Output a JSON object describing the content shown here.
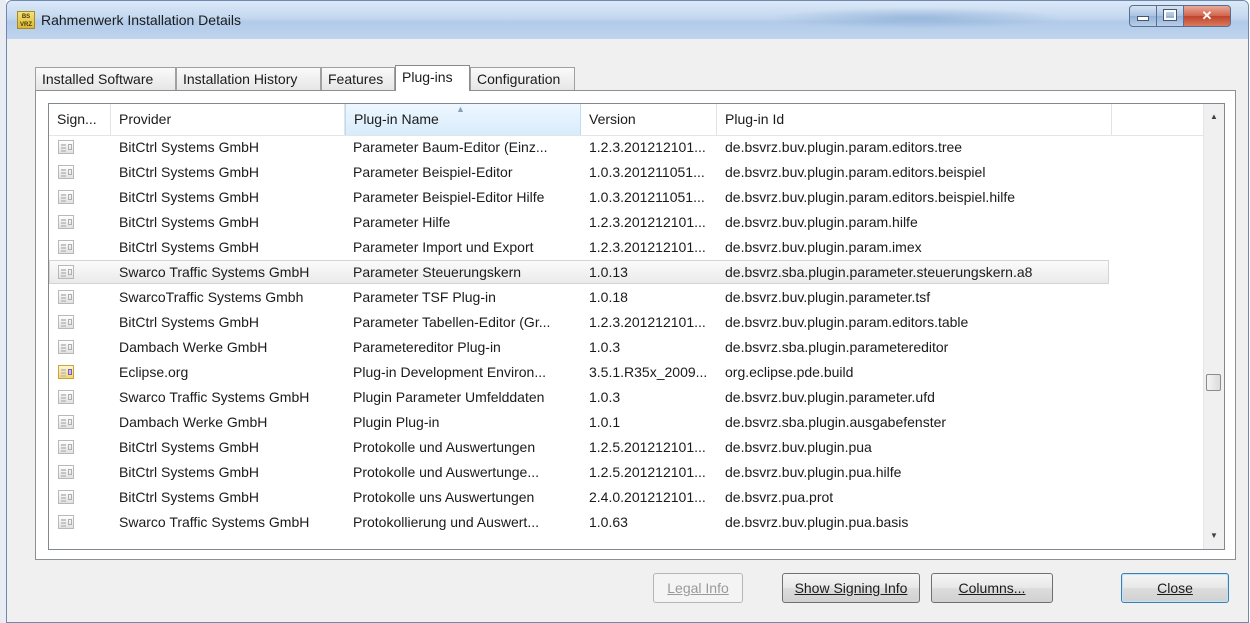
{
  "window": {
    "title": "Rahmenwerk Installation Details",
    "app_icon_text": "BS VRZ",
    "controls": [
      "minimize",
      "maximize",
      "close"
    ]
  },
  "tabs": [
    {
      "label": "Installed Software",
      "active": false
    },
    {
      "label": "Installation History",
      "active": false
    },
    {
      "label": "Features",
      "active": false
    },
    {
      "label": "Plug-ins",
      "active": true
    },
    {
      "label": "Configuration",
      "active": false
    }
  ],
  "table": {
    "columns": [
      "Sign...",
      "Provider",
      "Plug-in Name",
      "Version",
      "Plug-in Id"
    ],
    "sorted_column": "Plug-in Name",
    "selected_row": 5,
    "rows": [
      {
        "icon": "signed-icon",
        "provider": "BitCtrl Systems GmbH",
        "name": "Parameter Baum-Editor (Einz...",
        "version": "1.2.3.201212101...",
        "id": "de.bsvrz.buv.plugin.param.editors.tree"
      },
      {
        "icon": "signed-icon",
        "provider": "BitCtrl Systems GmbH",
        "name": "Parameter Beispiel-Editor",
        "version": "1.0.3.201211051...",
        "id": "de.bsvrz.buv.plugin.param.editors.beispiel"
      },
      {
        "icon": "signed-icon",
        "provider": "BitCtrl Systems GmbH",
        "name": "Parameter Beispiel-Editor Hilfe",
        "version": "1.0.3.201211051...",
        "id": "de.bsvrz.buv.plugin.param.editors.beispiel.hilfe"
      },
      {
        "icon": "signed-icon",
        "provider": "BitCtrl Systems GmbH",
        "name": "Parameter Hilfe",
        "version": "1.2.3.201212101...",
        "id": "de.bsvrz.buv.plugin.param.hilfe"
      },
      {
        "icon": "signed-icon",
        "provider": "BitCtrl Systems GmbH",
        "name": "Parameter Import und Export",
        "version": "1.2.3.201212101...",
        "id": "de.bsvrz.buv.plugin.param.imex"
      },
      {
        "icon": "signed-icon",
        "provider": "Swarco Traffic Systems GmbH",
        "name": "Parameter Steuerungskern",
        "version": "1.0.13",
        "id": "de.bsvrz.sba.plugin.parameter.steuerungskern.a8"
      },
      {
        "icon": "signed-icon",
        "provider": "SwarcoTraffic Systems Gmbh",
        "name": "Parameter TSF Plug-in",
        "version": "1.0.18",
        "id": "de.bsvrz.buv.plugin.parameter.tsf"
      },
      {
        "icon": "signed-icon",
        "provider": "BitCtrl Systems GmbH",
        "name": "Parameter Tabellen-Editor (Gr...",
        "version": "1.2.3.201212101...",
        "id": "de.bsvrz.buv.plugin.param.editors.table"
      },
      {
        "icon": "signed-icon",
        "provider": "Dambach Werke GmbH",
        "name": "Parametereditor Plug-in",
        "version": "1.0.3",
        "id": "de.bsvrz.sba.plugin.parametereditor"
      },
      {
        "icon": "eclipse-signed-icon",
        "provider": "Eclipse.org",
        "name": "Plug-in Development Environ...",
        "version": "3.5.1.R35x_2009...",
        "id": "org.eclipse.pde.build"
      },
      {
        "icon": "signed-icon",
        "provider": "Swarco Traffic Systems GmbH",
        "name": "Plugin Parameter Umfelddaten",
        "version": "1.0.3",
        "id": "de.bsvrz.buv.plugin.parameter.ufd"
      },
      {
        "icon": "signed-icon",
        "provider": "Dambach Werke GmbH",
        "name": "Plugin Plug-in",
        "version": "1.0.1",
        "id": "de.bsvrz.sba.plugin.ausgabefenster"
      },
      {
        "icon": "signed-icon",
        "provider": "BitCtrl Systems GmbH",
        "name": "Protokolle und Auswertungen",
        "version": "1.2.5.201212101...",
        "id": "de.bsvrz.buv.plugin.pua"
      },
      {
        "icon": "signed-icon",
        "provider": "BitCtrl Systems GmbH",
        "name": "Protokolle und Auswertunge...",
        "version": "1.2.5.201212101...",
        "id": "de.bsvrz.buv.plugin.pua.hilfe"
      },
      {
        "icon": "signed-icon",
        "provider": "BitCtrl Systems GmbH",
        "name": "Protokolle uns Auswertungen",
        "version": "2.4.0.201212101...",
        "id": "de.bsvrz.pua.prot"
      },
      {
        "icon": "signed-icon",
        "provider": "Swarco Traffic Systems GmbH",
        "name": "Protokollierung und Auswert...",
        "version": "1.0.63",
        "id": "de.bsvrz.buv.plugin.pua.basis"
      }
    ]
  },
  "buttons": {
    "legal_info": "Legal Info",
    "show_signing_info": "Show Signing Info",
    "columns": "Columns...",
    "close": "Close"
  }
}
